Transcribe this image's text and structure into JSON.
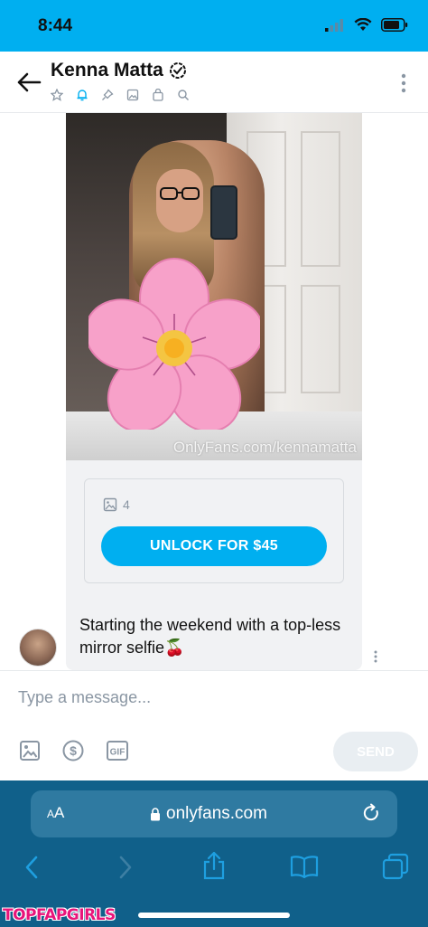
{
  "status_bar": {
    "time": "8:44"
  },
  "header": {
    "name": "Kenna Matta",
    "verified": true,
    "icons": [
      "star-icon",
      "bell-icon",
      "pin-icon",
      "image-icon",
      "lock-bag-icon",
      "search-icon"
    ]
  },
  "post": {
    "watermark": "OnlyFans.com/kennamatta",
    "media_count": "4",
    "unlock_label": "UNLOCK FOR $45",
    "message": "Starting the weekend with a top-less mirror selfie🍒"
  },
  "composer": {
    "placeholder": "Type a message...",
    "tools": [
      "image-icon",
      "dollar-icon",
      "gif-icon"
    ],
    "send_label": "SEND"
  },
  "browser": {
    "aa_label_small": "A",
    "aa_label_large": "A",
    "url": "onlyfans.com"
  },
  "watermark_tag": "TOPFAPGIRLS",
  "colors": {
    "accent": "#00aff0",
    "browser_bar": "#10608a",
    "bubble": "#f1f2f4"
  }
}
